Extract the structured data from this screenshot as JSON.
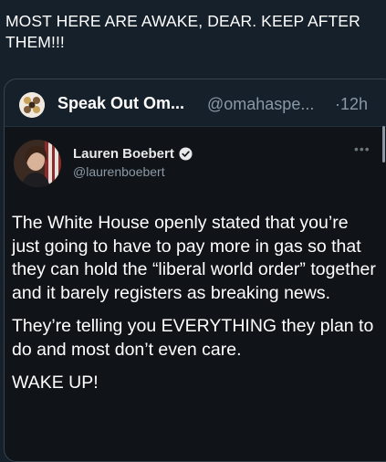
{
  "post": {
    "text": "MOST HERE ARE AWAKE, DEAR.  KEEP AFTER THEM!!!"
  },
  "quote": {
    "name": "Speak Out Om...",
    "handle": "@omahaspe...",
    "separator": "·",
    "time": "12h"
  },
  "tweet": {
    "name": "Lauren Boebert",
    "handle": "@laurenboebert",
    "more_icon": "more-dots-icon",
    "paragraphs": [
      "The White House openly stated that you’re just going to have to pay more in gas so that they can hold the “liberal world order” together and it barely registers as breaking news.",
      "They’re telling you EVERYTHING they plan to do and most don’t even care.",
      "WAKE UP!"
    ]
  },
  "colors": {
    "background": "#15202b",
    "inner_card": "#101418",
    "muted_text": "#8b98a5",
    "verified": "#e7e9ea"
  }
}
